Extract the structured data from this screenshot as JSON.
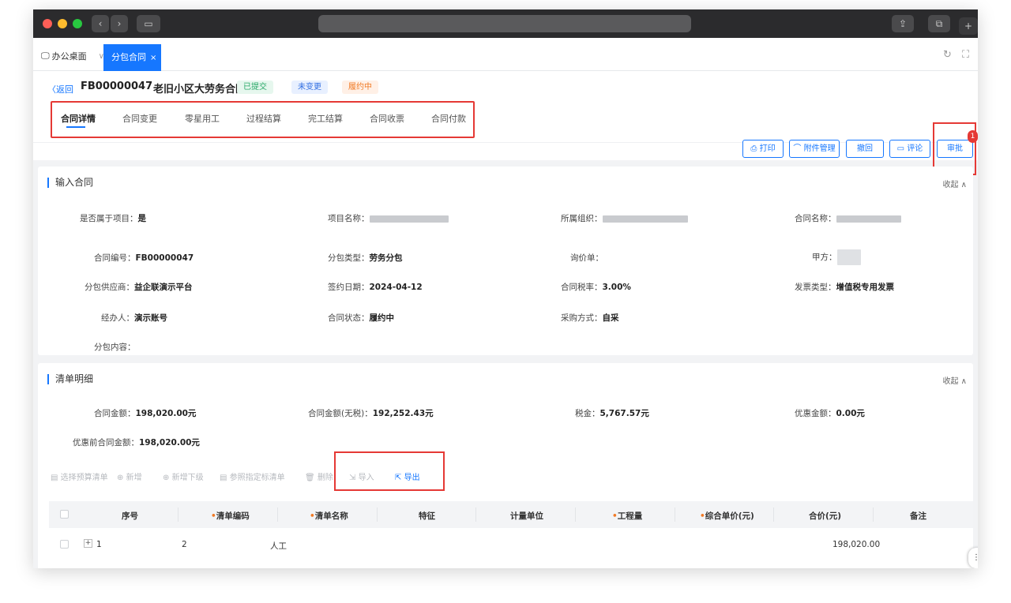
{
  "window": {
    "titlebar_colors": {
      "bg": "#2b2b2d",
      "red": "#fe5f57",
      "yellow": "#febc2e",
      "green": "#28c840"
    }
  },
  "app_tabs": {
    "home_label": "办公桌面",
    "active_label": "分包合同"
  },
  "header": {
    "back_label": "返回",
    "contract_code": "FB00000047",
    "contract_name": "老旧小区大劳务合同",
    "badges": [
      "已提交",
      "未变更",
      "履约中"
    ],
    "tabs": [
      "合同详情",
      "合同变更",
      "零星用工",
      "过程结算",
      "完工结算",
      "合同收票",
      "合同付款"
    ],
    "active_tab": "合同详情",
    "actions": [
      "打印",
      "附件管理",
      "撤回",
      "评论",
      "审批"
    ],
    "approve_badge_count": "1"
  },
  "input_contract": {
    "title": "输入合同",
    "collapse_label": "收起",
    "fields": {
      "is_project_label": "是否属于项目：",
      "is_project_value": "是",
      "project_name_label": "项目名称：",
      "org_label": "所属组织：",
      "contract_name_label": "合同名称：",
      "contract_no_label": "合同编号：",
      "contract_no_value": "FB00000047",
      "sub_type_label": "分包类型：",
      "sub_type_value": "劳务分包",
      "inquiry_label": "询价单：",
      "party_a_label": "甲方：",
      "supplier_label": "分包供应商：",
      "supplier_value": "益企联演示平台",
      "sign_date_label": "签约日期：",
      "sign_date_value": "2024-04-12",
      "tax_rate_label": "合同税率：",
      "tax_rate_value": "3.00%",
      "invoice_type_label": "发票类型：",
      "invoice_type_value": "增值税专用发票",
      "handler_label": "经办人：",
      "handler_value": "演示账号",
      "status_label": "合同状态：",
      "status_value": "履约中",
      "purchase_label": "采购方式：",
      "purchase_value": "自采",
      "content_label": "分包内容："
    }
  },
  "bill_detail": {
    "title": "清单明细",
    "collapse_label": "收起",
    "amount_label": "合同金额：",
    "amount_value": "198,020.00元",
    "amount_notax_label": "合同金额(无税)：",
    "amount_notax_value": "192,252.43元",
    "tax_label": "税金：",
    "tax_value": "5,767.57元",
    "discount_label": "优惠金额：",
    "discount_value": "0.00元",
    "pre_discount_label": "优惠前合同金额：",
    "pre_discount_value": "198,020.00元",
    "toolbar": [
      "选择预算清单",
      "新增",
      "新增下级",
      "参照指定标清单",
      "删除",
      "导入",
      "导出"
    ],
    "columns": [
      "序号",
      "清单编码",
      "清单名称",
      "特征",
      "计量单位",
      "工程量",
      "综合单价(元)",
      "合价(元)",
      "备注"
    ],
    "rows": [
      {
        "seq": "1",
        "code": "2",
        "name": "人工",
        "total": "198,020.00"
      }
    ]
  }
}
